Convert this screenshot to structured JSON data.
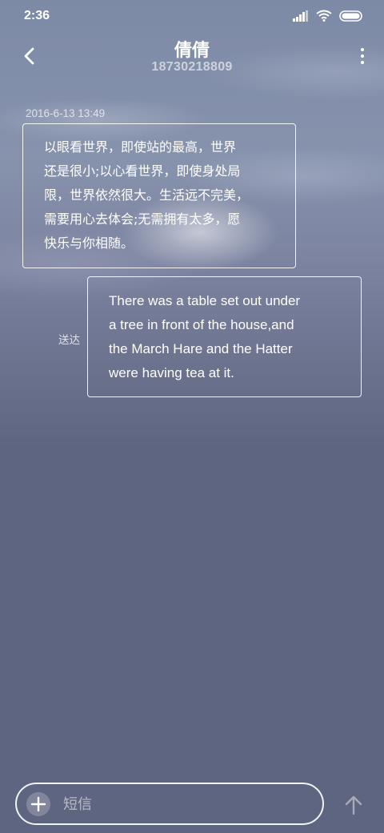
{
  "status_bar": {
    "time": "2:36"
  },
  "header": {
    "title": "倩倩",
    "phone": "18730218809"
  },
  "conversation": {
    "timestamp": "2016-6-13 13:49",
    "messages": [
      {
        "direction": "incoming",
        "lines": [
          "以眼看世界，即使站的最高，世界",
          "还是很小;以心看世界，即使身处局",
          "限，世界依然很大。生活远不完美，",
          "需要用心去体会;无需拥有太多，愿",
          "快乐与你相随。"
        ]
      },
      {
        "direction": "outgoing",
        "status": "送达",
        "lines": [
          "There was a table set out under",
          "a tree in front of the house,and",
          "the March Hare and the Hatter",
          "were having tea at it."
        ]
      }
    ]
  },
  "composer": {
    "placeholder": "短信"
  },
  "icons": {
    "signal": "signal-icon",
    "wifi": "wifi-icon",
    "battery": "battery-icon",
    "back": "back-arrow-icon",
    "more": "more-vertical-icon",
    "add": "plus-icon",
    "send": "send-arrow-icon"
  }
}
